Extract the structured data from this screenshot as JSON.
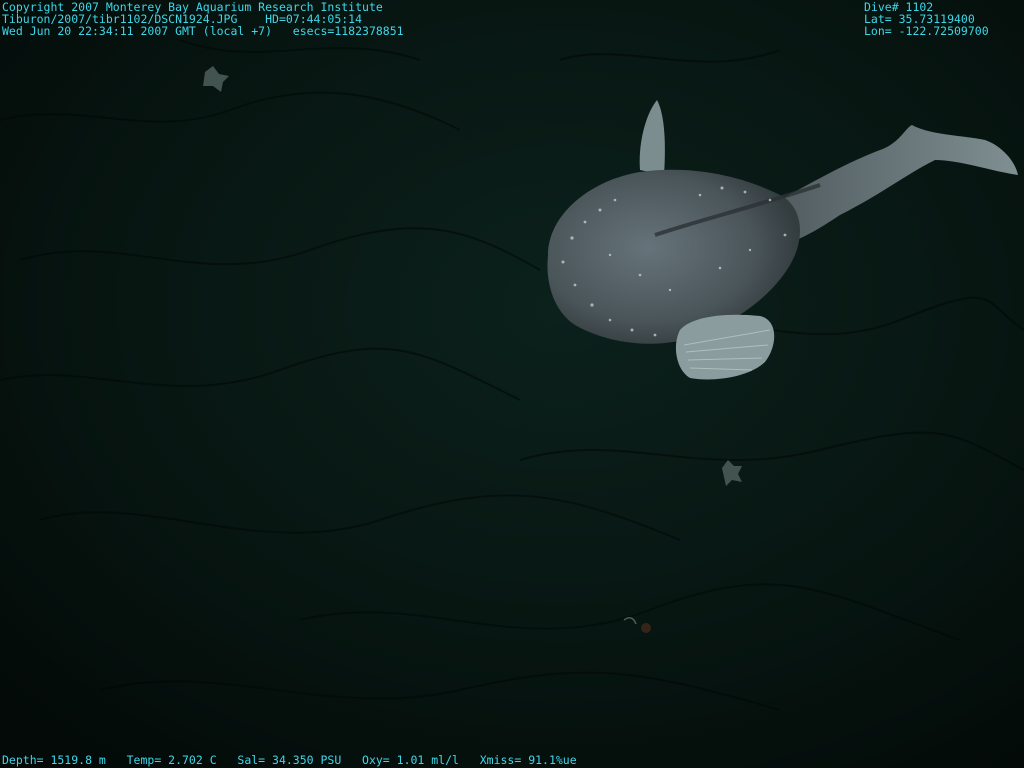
{
  "overlay": {
    "top_left": {
      "line1": "Copyright 2007 Monterey Bay Aquarium Research Institute",
      "line2": "Tiburon/2007/tibr1102/DSCN1924.JPG    HD=07:44:05:14",
      "line3": "Wed Jun 20 22:34:11 2007 GMT (local +7)   esecs=1182378851"
    },
    "top_right": {
      "dive": "Dive# 1102",
      "lat": "Lat= 35.73119400",
      "lon": "Lon= -122.72509700"
    },
    "bottom": {
      "sensors": "Depth= 1519.8 m   Temp= 2.702 C   Sal= 34.350 PSU   Oxy= 1.01 ml/l   Xmiss= 91.1%ue"
    },
    "text_color": "#3fd6e8"
  },
  "scene": {
    "background_color": "#05120f",
    "seafloor_color": "#0a1a16",
    "fish_color": "#5f6e6e",
    "fin_color": "#8fa6a6"
  }
}
